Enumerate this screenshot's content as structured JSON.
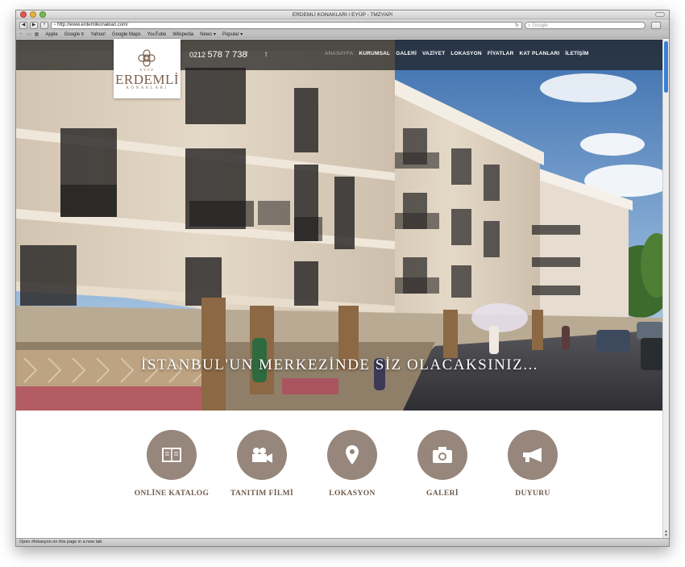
{
  "window": {
    "title": "ERDEMLİ KONAKLARI / EYÜP - TMZYAPI"
  },
  "toolbar": {
    "back": "◀",
    "forward": "▶",
    "add": "+",
    "url": "http://www.erdemlikonaklari.com/",
    "search_placeholder": "Google"
  },
  "bookmarks": [
    "Apple",
    "Google tr",
    "Yahoo!",
    "Google Maps",
    "YouTube",
    "Wikipedia",
    "News ▾",
    "Popular ▾"
  ],
  "header": {
    "logo_top": "EYÜP",
    "logo_main": "ERDEMLİ",
    "logo_sub": "KONAKLARI",
    "phone_prefix": "0212",
    "phone_number": "578 7 738",
    "facebook_icon": "f",
    "twitter_icon": "t"
  },
  "nav": {
    "items": [
      "ANASAYFA",
      "KURUMSAL",
      "GALERİ",
      "VAZİYET",
      "LOKASYON",
      "FİYATLAR",
      "KAT PLANLARI",
      "İLETİŞİM"
    ],
    "active": "ANASAYFA"
  },
  "hero": {
    "tagline": "İSTANBUL'UN MERKEZİNDE SİZ OLACAKSINIZ..."
  },
  "features": [
    {
      "label": "ONLİNE KATALOG",
      "icon": "book-icon"
    },
    {
      "label": "TANITIM FİLMİ",
      "icon": "video-camera-icon"
    },
    {
      "label": "LOKASYON",
      "icon": "map-pin-icon"
    },
    {
      "label": "GALERİ",
      "icon": "camera-icon"
    },
    {
      "label": "DUYURU",
      "icon": "megaphone-icon"
    }
  ],
  "status": {
    "text": "Open #lokasyon on this page in a new tab"
  },
  "colors": {
    "accent": "#96867b",
    "label": "#6e5a4c",
    "nav_bg": "#1e1e1e"
  }
}
